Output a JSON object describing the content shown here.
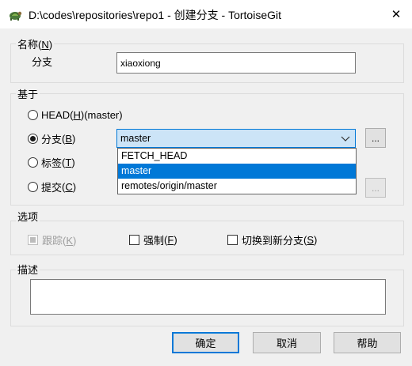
{
  "window": {
    "title": "D:\\codes\\repositories\\repo1 - 创建分支 - TortoiseGit",
    "close_glyph": "✕",
    "icon": "tortoisegit-icon"
  },
  "name_group": {
    "label": "名称",
    "label_key": "N",
    "branch_label": "分支",
    "branch_value": "xiaoxiong"
  },
  "base_group": {
    "label": "基于",
    "head_option": {
      "text": "HEAD",
      "key": "H",
      "suffix": " (master)"
    },
    "branch_option": {
      "text": "分支",
      "key": "B"
    },
    "tag_option": {
      "text": "标签",
      "key": "T"
    },
    "commit_option": {
      "text": "提交",
      "key": "C"
    },
    "selected": "branch",
    "branch_combo_value": "master",
    "browse_label": "...",
    "dropdown_items": [
      "FETCH_HEAD",
      "master",
      "remotes/origin/master"
    ],
    "dropdown_selected_index": 1
  },
  "options_group": {
    "label": "选项",
    "track": {
      "text": "跟踪",
      "key": "K",
      "checked": true,
      "disabled": true
    },
    "force": {
      "text": "强制",
      "key": "F",
      "checked": false
    },
    "switch": {
      "text": "切换到新分支",
      "key": "S",
      "checked": false
    }
  },
  "desc_group": {
    "label": "描述",
    "value": ""
  },
  "buttons": {
    "ok": "确定",
    "cancel": "取消",
    "help": "帮助"
  },
  "colors": {
    "accent": "#0078d7",
    "background": "#f0f0f0"
  }
}
